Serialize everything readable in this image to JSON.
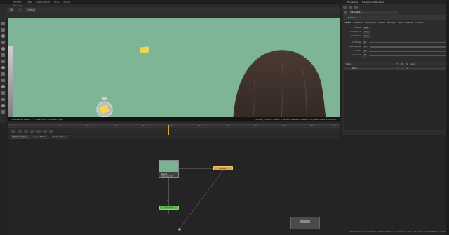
{
  "menubar": {
    "items": [
      "Viewer1",
      "rgba",
      "rgba.alpha",
      "RGB",
      "sRGB"
    ]
  },
  "viewer": {
    "tab_label": "Tracker1",
    "toolbar": {
      "zoom": "f/8",
      "frame": "1",
      "mode": "Default"
    },
    "info_left": "1960x1080 Base - 1:1 1882 1624 channels: rgba",
    "info_right": "x=1310 y=856 0.12602 0.34901 0.18801 0.00000 H:0.38 S:0.64 V:0.35 L:0.27"
  },
  "timeline": {
    "ticks": [
      "1",
      "100",
      "150",
      "200",
      "250",
      "300",
      "350",
      "400",
      "450",
      "500",
      "550",
      "600"
    ],
    "playhead": "101"
  },
  "node_graph": {
    "tabs": [
      {
        "label": "Node Graph",
        "active": true
      },
      {
        "label": "Curve Editor",
        "active": false
      },
      {
        "label": "Dope Sheet",
        "active": false
      }
    ],
    "read_node": {
      "label": "Read1",
      "sub": "P1207-02.MP4"
    },
    "tracker_node": {
      "label": "Tracker1"
    },
    "viewer_node": {
      "label": "Viewer1"
    },
    "dot_label": "Yo",
    "status": "Channel Count: 10 Localization Mode: On Memory: 3.4 GB (21.2%) CPU: 14.2% Disk: 0.0 MB/s Network: 0.0 MB/s"
  },
  "properties": {
    "tabs": [
      "Properties",
      "Background Renders"
    ],
    "node_name": "Tracker1",
    "node_class": "Tracker1",
    "prop_tabs": [
      {
        "label": "Tracker",
        "active": true
      },
      {
        "label": "Transform",
        "active": false
      },
      {
        "label": "Motion Blur",
        "active": false
      },
      {
        "label": "Output",
        "active": false
      },
      {
        "label": "Settings",
        "active": false
      },
      {
        "label": "Track",
        "active": false
      },
      {
        "label": "Lifetime",
        "active": false
      },
      {
        "label": "Tracking",
        "active": false
      }
    ],
    "rows": [
      {
        "label": "output",
        "value": "rgba"
      },
      {
        "label": "premultiplied",
        "value": "none"
      },
      {
        "label": "transform",
        "value": "none"
      },
      {
        "label": "ref frame",
        "value": "1"
      },
      {
        "label": "jitter period",
        "value": "10"
      },
      {
        "label": "smooth",
        "value": "0"
      },
      {
        "label": "smooth R",
        "value": "0"
      }
    ],
    "tracks_header": [
      "Name",
      "T",
      "R",
      "S",
      "error"
    ],
    "track": {
      "name": "track 1",
      "t": "✓",
      "r": "✓",
      "s": "✓"
    }
  }
}
